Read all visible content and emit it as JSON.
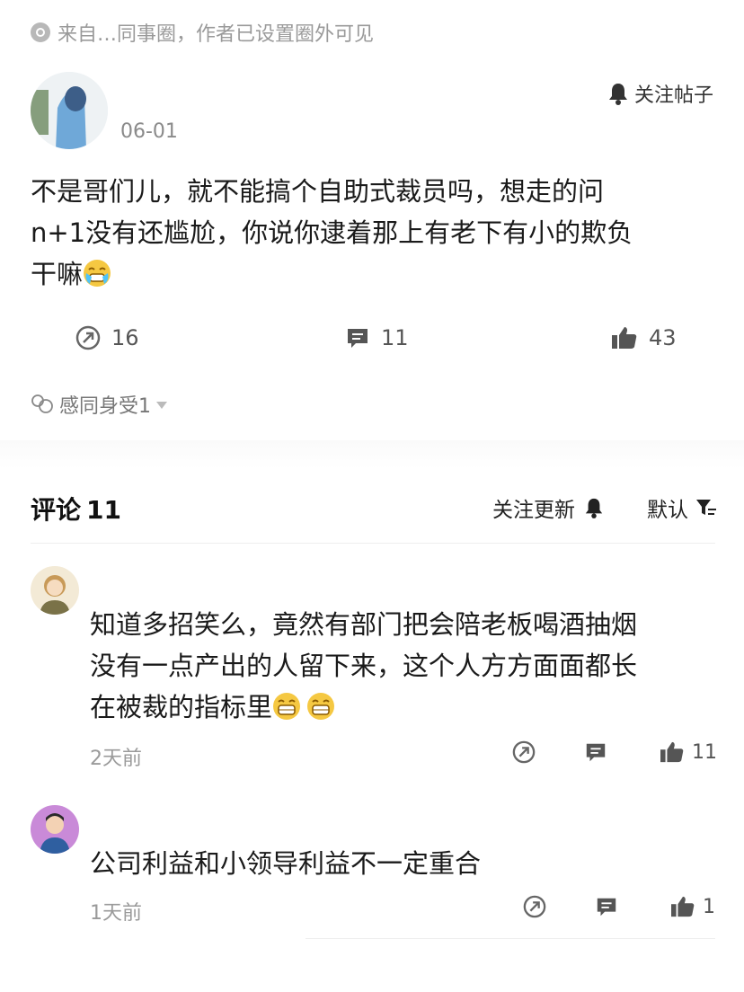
{
  "post": {
    "source_text": "来自…同事圈，作者已设置圈外可见",
    "date": "06-01",
    "follow_post_label": "关注帖子",
    "body_lines": [
      "不是哥们儿，就不能搞个自助式裁员吗，想走的问",
      "n+1没有还尴尬，你说你逮着那上有老下有小的欺负",
      "干嘛"
    ],
    "emoji_icon": "laugh-cry-emoji",
    "share_count": "16",
    "comment_count": "11",
    "like_count": "43",
    "reaction_text": "感同身受1"
  },
  "comments_header": {
    "title": "评论",
    "count": "11",
    "follow_updates_label": "关注更新",
    "sort_label": "默认"
  },
  "comments": [
    {
      "text_lines": [
        "知道多招笑么，竟然有部门把会陪老板喝酒抽烟",
        "没有一点产出的人留下来，这个人方方面面都长",
        "在被裁的指标里"
      ],
      "time": "2天前",
      "like_count": "11"
    },
    {
      "text_lines": [
        "公司利益和小领导利益不一定重合"
      ],
      "time": "1天前",
      "like_count": "1"
    }
  ],
  "colors": {
    "text": "#1a1a1a",
    "muted": "#9a9a9a",
    "icon": "#666666",
    "divider": "#eeeeee"
  }
}
